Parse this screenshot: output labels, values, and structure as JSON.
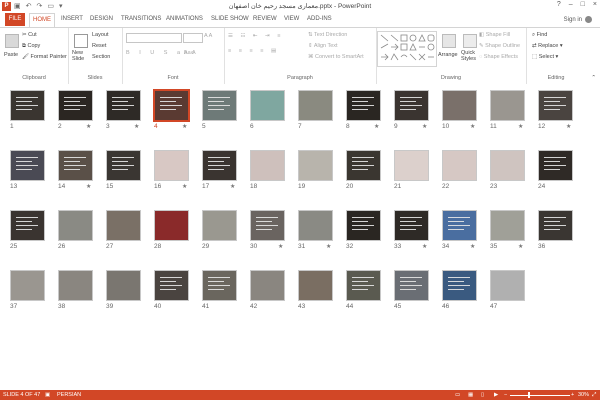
{
  "window": {
    "title": "معماری مسجد رحیم خان اصفهان.pptx - PowerPoint",
    "app_icon": "P",
    "signin": "Sign in",
    "controls": [
      "?",
      "–",
      "□",
      "×"
    ]
  },
  "ribbon_tabs": [
    "FILE",
    "HOME",
    "INSERT",
    "DESIGN",
    "TRANSITIONS",
    "ANIMATIONS",
    "SLIDE SHOW",
    "REVIEW",
    "VIEW",
    "ADD-INS"
  ],
  "active_tab": "HOME",
  "clipboard": {
    "paste": "Paste",
    "cut": "Cut",
    "copy": "Copy",
    "format_painter": "Format Painter",
    "label": "Clipboard"
  },
  "slides_group": {
    "new_slide": "New Slide",
    "layout": "Layout",
    "reset": "Reset",
    "section": "Section",
    "label": "Slides"
  },
  "font_group": {
    "label": "Font"
  },
  "paragraph_group": {
    "text_direction": "Text Direction",
    "align_text": "Align Text",
    "convert_smartart": "Convert to SmartArt",
    "label": "Paragraph"
  },
  "drawing_group": {
    "arrange": "Arrange",
    "quick_styles": "Quick Styles",
    "shape_fill": "Shape Fill",
    "shape_outline": "Shape Outline",
    "shape_effects": "Shape Effects",
    "label": "Drawing"
  },
  "editing_group": {
    "find": "Find",
    "replace": "Replace",
    "select": "Select",
    "label": "Editing"
  },
  "status": {
    "slide_info": "SLIDE 4 OF 47",
    "language": "PERSIAN",
    "zoom": "30%",
    "zoom_fraction": 0.3
  },
  "selected_slide": 4,
  "starred_slides": [
    2,
    3,
    4,
    8,
    9,
    10,
    11,
    12,
    14,
    16,
    17,
    30,
    31,
    33,
    34,
    35
  ],
  "slides": [
    {
      "n": "1",
      "c": "#3a3530"
    },
    {
      "n": "2",
      "c": "#2b2622"
    },
    {
      "n": "3",
      "c": "#2e2a26"
    },
    {
      "n": "4",
      "c": "#5a3a32"
    },
    {
      "n": "5",
      "c": "#6e7a78"
    },
    {
      "n": "6",
      "c": "#7fa7a0"
    },
    {
      "n": "7",
      "c": "#8a8a80"
    },
    {
      "n": "8",
      "c": "#2a2622"
    },
    {
      "n": "9",
      "c": "#3a3430"
    },
    {
      "n": "10",
      "c": "#7a706a"
    },
    {
      "n": "11",
      "c": "#9a9690"
    },
    {
      "n": "12",
      "c": "#4a4440"
    },
    {
      "n": "13",
      "c": "#4a4a54"
    },
    {
      "n": "14",
      "c": "#5a5048"
    },
    {
      "n": "15",
      "c": "#3a3632"
    },
    {
      "n": "16",
      "c": "#d8c8c4"
    },
    {
      "n": "17",
      "c": "#3a3430"
    },
    {
      "n": "18",
      "c": "#cec0bc"
    },
    {
      "n": "19",
      "c": "#b8b4ac"
    },
    {
      "n": "20",
      "c": "#3a3630"
    },
    {
      "n": "21",
      "c": "#dcd0cc"
    },
    {
      "n": "22",
      "c": "#d6c8c4"
    },
    {
      "n": "23",
      "c": "#cfc4c0"
    },
    {
      "n": "24",
      "c": "#2f2a26"
    },
    {
      "n": "25",
      "c": "#3a3430"
    },
    {
      "n": "26",
      "c": "#8a8a84"
    },
    {
      "n": "27",
      "c": "#7a7066"
    },
    {
      "n": "28",
      "c": "#8a2a2a"
    },
    {
      "n": "29",
      "c": "#9a9890"
    },
    {
      "n": "30",
      "c": "#6a6460"
    },
    {
      "n": "31",
      "c": "#8a8a84"
    },
    {
      "n": "32",
      "c": "#2a2622"
    },
    {
      "n": "33",
      "c": "#2e2a26"
    },
    {
      "n": "34",
      "c": "#4a6ea0"
    },
    {
      "n": "35",
      "c": "#a0a098"
    },
    {
      "n": "36",
      "c": "#3a3632"
    },
    {
      "n": "37",
      "c": "#9a9690"
    },
    {
      "n": "38",
      "c": "#8a8680"
    },
    {
      "n": "39",
      "c": "#7a7670"
    },
    {
      "n": "40",
      "c": "#4a4440"
    },
    {
      "n": "41",
      "c": "#6a665e"
    },
    {
      "n": "42",
      "c": "#8a8680"
    },
    {
      "n": "43",
      "c": "#7a6e62"
    },
    {
      "n": "44",
      "c": "#5a5a50"
    },
    {
      "n": "45",
      "c": "#6a6e74"
    },
    {
      "n": "46",
      "c": "#3a5a80"
    },
    {
      "n": "47",
      "c": "#b0b0b0"
    }
  ]
}
